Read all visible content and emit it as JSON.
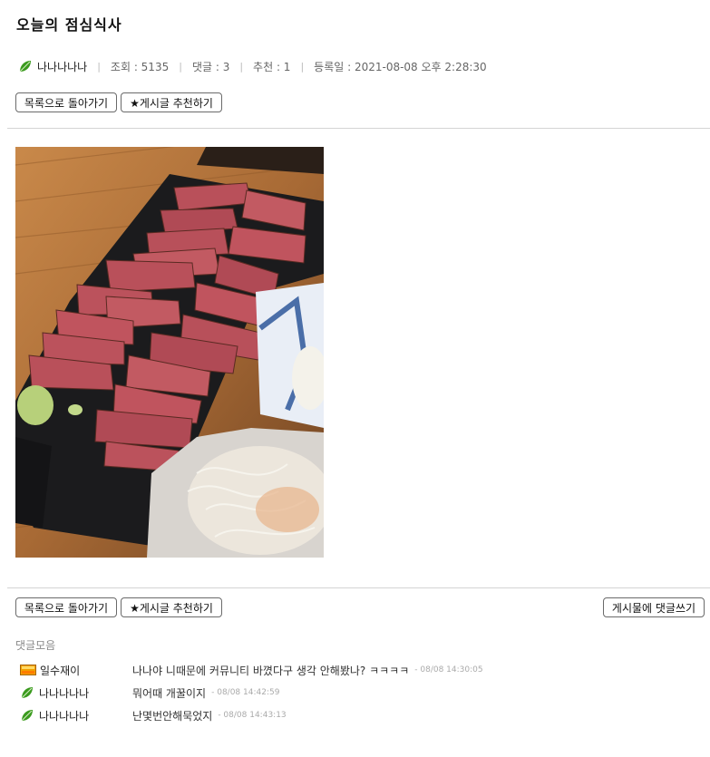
{
  "post": {
    "title": "오늘의 점심식사",
    "author": "나나나나나",
    "views": "조회 : 5135",
    "comments_count": "댓글 : 3",
    "recommend": "추천 : 1",
    "date": "등록일 : 2021-08-08 오후 2:28:30"
  },
  "buttons": {
    "back_to_list": "목록으로 돌아가기",
    "recommend_post": "★게시글 추천하기",
    "write_comment": "게시물에 댓글쓰기"
  },
  "comments_section": {
    "label": "댓글모음",
    "items": [
      {
        "author": "일수재이",
        "icon": "rank-badge-icon",
        "text": "나나야 니때문에 커뮤니티 바꼈다구 생각 안해봤나? ㅋㅋㅋㅋ",
        "timestamp": "- 08/08 14:30:05"
      },
      {
        "author": "나나나나나",
        "icon": "leaf-icon",
        "text": "뭐어때 개꿀이지",
        "timestamp": "- 08/08 14:42:59"
      },
      {
        "author": "나나나나나",
        "icon": "leaf-icon",
        "text": "난몇번안해묵었지",
        "timestamp": "- 08/08 14:43:13"
      }
    ]
  },
  "image": {
    "alt_semantic": "food-photo"
  },
  "colors": {
    "leaf_green": "#3a9a1e",
    "rank_orange": "#f2a100",
    "divider": "#d4d4d4"
  }
}
